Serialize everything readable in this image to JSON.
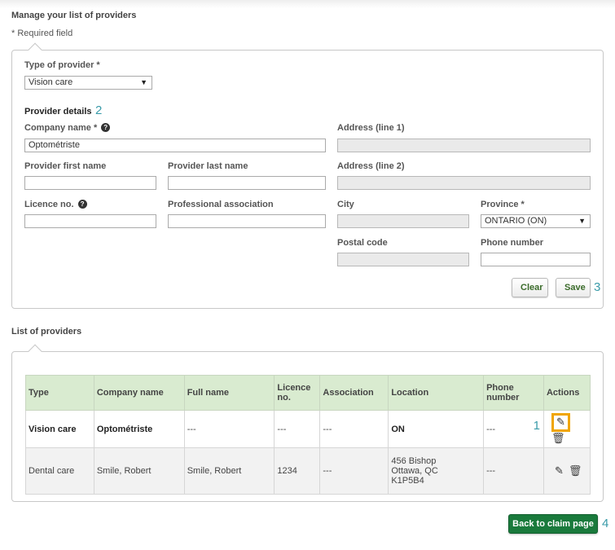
{
  "page": {
    "title": "Manage your list of providers",
    "required_note": "* Required field"
  },
  "form": {
    "provider_type": {
      "label": "Type of provider *",
      "value": "Vision care"
    },
    "details_heading": "Provider details",
    "details_step": "2",
    "company_name": {
      "label": "Company name *",
      "value": "Optométriste"
    },
    "address_line1": {
      "label": "Address (line 1)",
      "value": ""
    },
    "first_name": {
      "label": "Provider first name",
      "value": ""
    },
    "last_name": {
      "label": "Provider last name",
      "value": ""
    },
    "address_line2": {
      "label": "Address (line 2)",
      "value": ""
    },
    "licence": {
      "label": "Licence no.",
      "value": ""
    },
    "association": {
      "label": "Professional association",
      "value": ""
    },
    "city": {
      "label": "City",
      "value": ""
    },
    "province": {
      "label": "Province *",
      "value": "ONTARIO (ON)"
    },
    "postal_code": {
      "label": "Postal code",
      "value": ""
    },
    "phone": {
      "label": "Phone number",
      "value": ""
    },
    "clear_label": "Clear",
    "save_label": "Save",
    "save_step": "3"
  },
  "list": {
    "title": "List of providers",
    "columns": [
      "Type",
      "Company name",
      "Full name",
      "Licence\nno.",
      "Association",
      "Location",
      "Phone number",
      "Actions"
    ],
    "rows": [
      {
        "type": "Vision care",
        "company": "Optométriste",
        "full_name": "---",
        "licence": "---",
        "association": "---",
        "location": [
          "ON"
        ],
        "phone": "---",
        "step": "1"
      },
      {
        "type": "Dental care",
        "company": "Smile, Robert",
        "full_name": "Smile, Robert",
        "licence": "1234",
        "association": "---",
        "location": [
          "456 Bishop",
          "Ottawa, QC",
          "K1P5B4"
        ],
        "phone": "---"
      }
    ]
  },
  "footer": {
    "back_label": "Back to claim page",
    "back_step": "4"
  },
  "icons": {
    "edit": "pencil-icon",
    "delete": "trash-icon",
    "help": "question-circle-icon",
    "dropdown": "caret-down-icon"
  },
  "colors": {
    "accent_green": "#1a7a3c",
    "header_green": "#d9ebd0",
    "step_teal": "#3a9ba9",
    "highlight": "#f0a500"
  }
}
